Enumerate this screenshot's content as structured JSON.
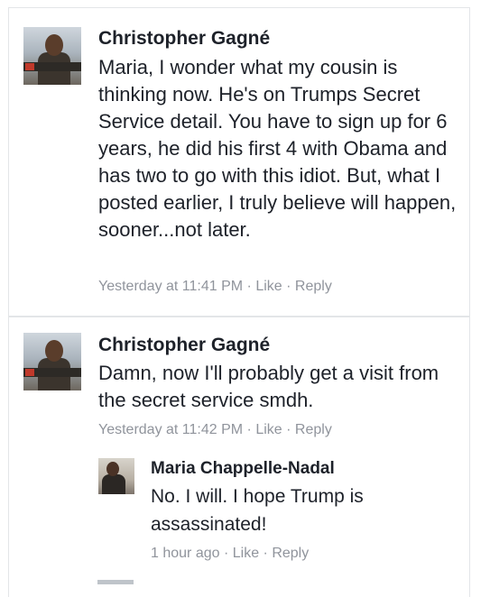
{
  "comments": [
    {
      "author": "Christopher Gagné",
      "text": "Maria, I wonder what my cousin is thinking now. He's on Trumps Secret Service detail. You have to sign up for 6 years, he did his first 4 with Obama and has two to go with this idiot. But, what I posted earlier, I truly believe will happen, sooner...not later.",
      "time": "Yesterday at 11:41 PM",
      "sep": " · ",
      "like": "Like",
      "reply": "Reply",
      "avatar_icon": "profile-photo-icon"
    },
    {
      "author": "Christopher Gagné",
      "text": "Damn, now I'll probably get a visit from the secret service smdh.",
      "time": "Yesterday at 11:42 PM",
      "sep": " · ",
      "like": "Like",
      "reply": "Reply",
      "avatar_icon": "profile-photo-icon"
    }
  ],
  "reply": {
    "author": "Maria Chappelle-Nadal",
    "text": "No. I will. I hope Trump is assassinated!",
    "time": "1 hour ago",
    "sep": " · ",
    "like": "Like",
    "reply": "Reply",
    "avatar_icon": "profile-photo-icon"
  },
  "colors": {
    "text": "#1d2129",
    "meta": "#90949c",
    "border": "#e3e5e8"
  }
}
